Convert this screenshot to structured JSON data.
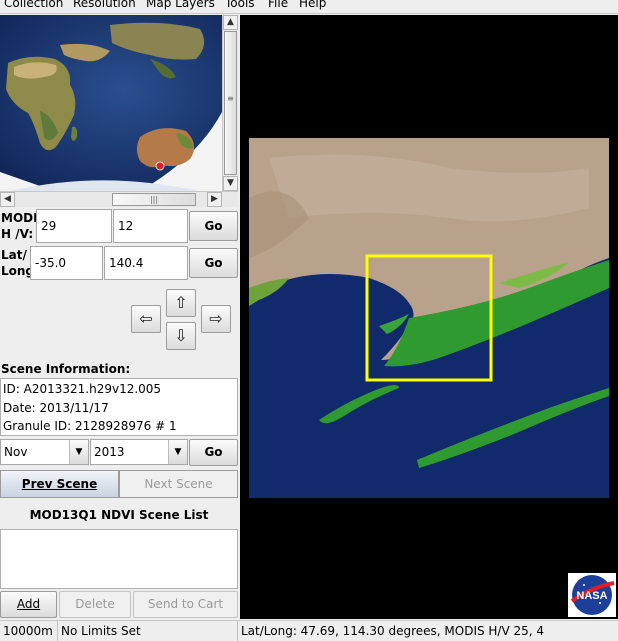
{
  "menu": [
    "Collection",
    "Resolution",
    "Map Layers",
    "Tools",
    "File",
    "Help"
  ],
  "modis": {
    "label_line1": "MODIS",
    "label_line2": "H /V:",
    "h": "29",
    "v": "12",
    "go": "Go"
  },
  "latlong": {
    "label_line1": "Lat/",
    "label_line2": "Long:",
    "lat": "-35.0",
    "long": "140.4",
    "go": "Go"
  },
  "arrows": {
    "up": "⇧",
    "left": "⇦",
    "right": "⇨",
    "down": "⇩"
  },
  "scene_info": {
    "title": "Scene Information:",
    "id": "ID: A2013321.h29v12.005",
    "date": "Date: 2013/11/17",
    "granule": "Granule ID: 2128928976  # 1"
  },
  "date_select": {
    "month": "Nov",
    "year": "2013",
    "go": "Go"
  },
  "nav": {
    "prev": "Prev Scene",
    "next": "Next Scene"
  },
  "scene_list": {
    "title": "MOD13Q1 NDVI Scene List",
    "items": []
  },
  "actions": {
    "add": "Add",
    "delete": "Delete",
    "send": "Send to Cart"
  },
  "status": {
    "resolution": "10000m",
    "limits": "No Limits Set",
    "cursor": "Lat/Long:  47.69,  114.30 degrees, MODIS H/V  25, 4"
  },
  "logo": {
    "text": "NASA"
  },
  "colors": {
    "ocean": "#112a6b",
    "land": "#b9a28c",
    "vegetation": "#2f9a2f",
    "selection": "#ffff00"
  }
}
